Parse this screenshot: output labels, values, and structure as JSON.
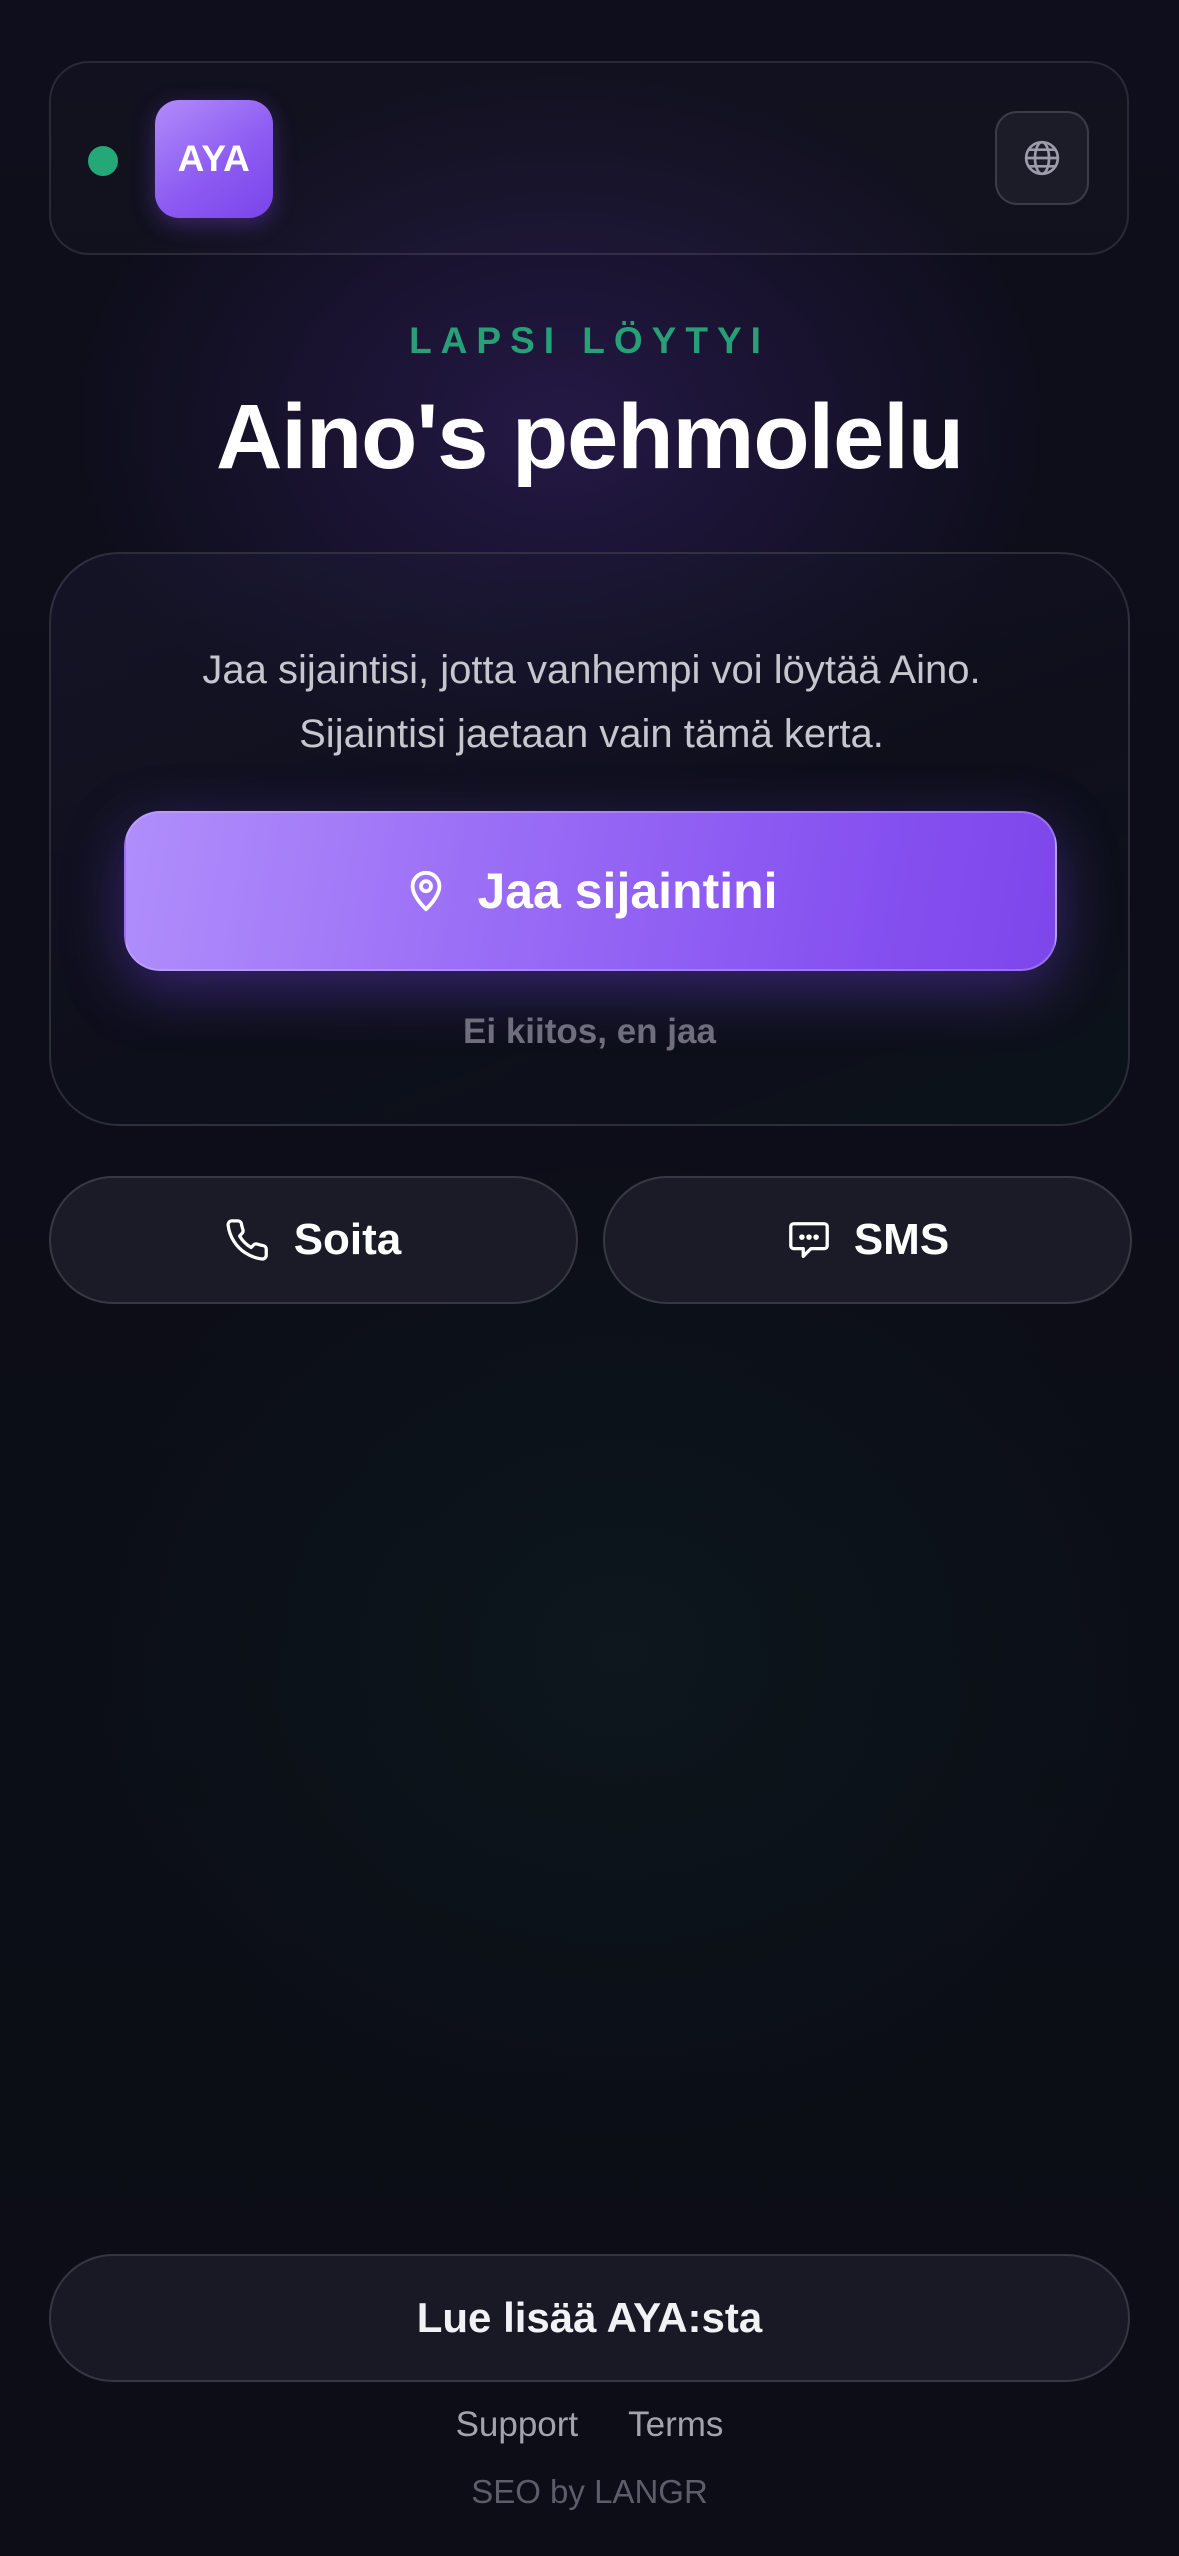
{
  "header": {
    "logo_text": "AYA",
    "status_color": "#24a878",
    "language_icon": "globe-icon"
  },
  "hero": {
    "eyebrow": "LAPSI LÖYTYI",
    "title": "Aino's pehmolelu"
  },
  "share_card": {
    "description_line1": "Jaa sijaintisi, jotta vanhempi voi löytää Aino.",
    "description_line2": "Sijaintisi jaetaan vain tämä kerta.",
    "share_button_label": "Jaa sijaintini",
    "share_button_icon": "location-pin-icon",
    "decline_label": "Ei kiitos, en jaa"
  },
  "contact": {
    "call_label": "Soita",
    "call_icon": "phone-icon",
    "sms_label": "SMS",
    "sms_icon": "chat-bubble-icon"
  },
  "footer": {
    "learn_more_label": "Lue lisää AYA:sta",
    "links": [
      "Support",
      "Terms"
    ],
    "credit": "SEO by LANGR"
  },
  "colors": {
    "accent_purple": "#8d5cf2",
    "accent_green": "#27a077",
    "background": "#0d0e18"
  }
}
